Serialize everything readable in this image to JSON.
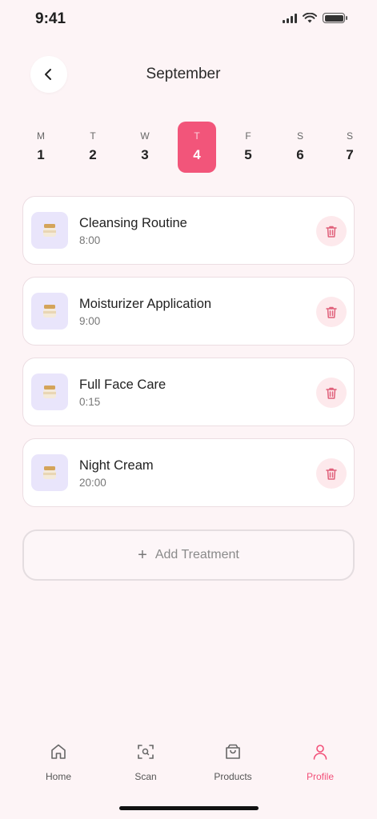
{
  "status_bar": {
    "time": "9:41",
    "signal_icon": "signal-icon",
    "wifi_icon": "wifi-icon",
    "battery_icon": "battery-icon"
  },
  "header": {
    "month": "September",
    "back_icon": "chevron-left-icon"
  },
  "week": {
    "days": [
      {
        "dow": "M",
        "num": "1"
      },
      {
        "dow": "T",
        "num": "2"
      },
      {
        "dow": "W",
        "num": "3"
      },
      {
        "dow": "T",
        "num": "4",
        "selected": true
      },
      {
        "dow": "F",
        "num": "5"
      },
      {
        "dow": "S",
        "num": "6"
      },
      {
        "dow": "S",
        "num": "7"
      }
    ]
  },
  "treatments": [
    {
      "title": "Cleansing Routine",
      "time": "8:00"
    },
    {
      "title": "Moisturizer Application",
      "time": "9:00"
    },
    {
      "title": "Full Face Care",
      "time": "0:15"
    },
    {
      "title": "Night Cream",
      "time": "20:00"
    }
  ],
  "add_button": {
    "label": "Add Treatment",
    "icon": "plus-icon"
  },
  "tabbar": {
    "items": [
      {
        "label": "Home",
        "icon": "home-icon"
      },
      {
        "label": "Scan",
        "icon": "scan-icon"
      },
      {
        "label": "Products",
        "icon": "shopping-bag-icon"
      },
      {
        "label": "Profile",
        "icon": "user-icon",
        "active": true
      }
    ]
  },
  "colors": {
    "accent": "#f2557a",
    "background": "#fdf4f6",
    "thumb_bg": "#e9e5fb",
    "delete_bg": "#fde9ec",
    "delete_icon": "#e0607a"
  }
}
